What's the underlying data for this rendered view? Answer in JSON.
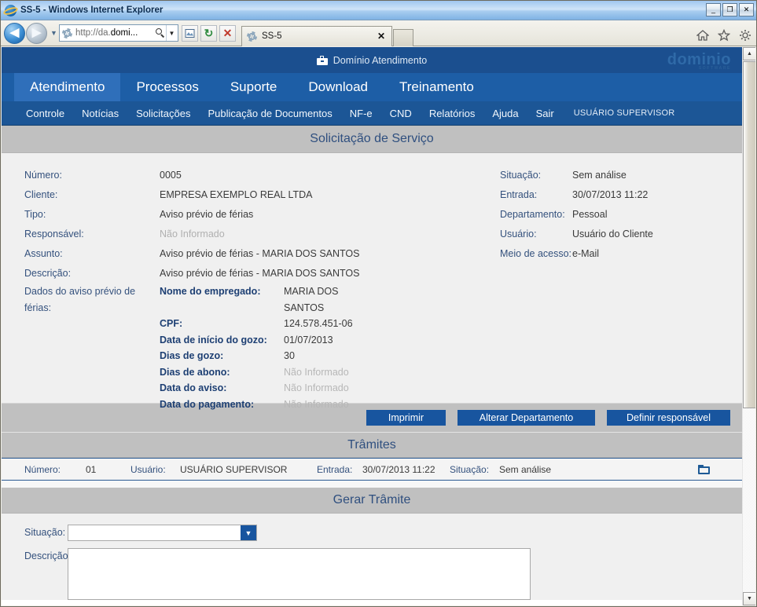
{
  "browser": {
    "title": "SS-5 - Windows Internet Explorer",
    "minimize_label": "_",
    "maximize_label": "❐",
    "close_label": "✕",
    "address_value_prefix": "http://da.",
    "address_value_suffix": "domi...",
    "back_label": "◀",
    "forward_label": "▶",
    "history_caret": "▼",
    "address_caret": "▼",
    "compat_icon": "compatibility-view-icon",
    "refresh_label": "↻",
    "stop_label": "✕",
    "tab_title": "SS-5",
    "tab_close_label": "✕",
    "home_icon": "home-icon",
    "favorites_icon": "star-icon",
    "tools_icon": "gear-icon"
  },
  "app": {
    "brand": "Domínio Atendimento",
    "logo": "dominio",
    "logo_sub": "SOFTWARE",
    "tabs": [
      {
        "label": "Atendimento",
        "active": true
      },
      {
        "label": "Processos",
        "active": false
      },
      {
        "label": "Suporte",
        "active": false
      },
      {
        "label": "Download",
        "active": false
      },
      {
        "label": "Treinamento",
        "active": false
      }
    ],
    "submenu": [
      "Controle",
      "Notícias",
      "Solicitações",
      "Publicação de Documentos",
      "NF-e",
      "CND",
      "Relatórios",
      "Ajuda",
      "Sair"
    ],
    "user": "USUÁRIO SUPERVISOR"
  },
  "page": {
    "section_title": "Solicitação de Serviço",
    "left_fields": [
      {
        "label": "Número:",
        "value": "0005",
        "muted": false
      },
      {
        "label": "Cliente:",
        "value": "EMPRESA EXEMPLO REAL LTDA",
        "muted": false
      },
      {
        "label": "Tipo:",
        "value": "Aviso prévio de férias",
        "muted": false
      },
      {
        "label": "Responsável:",
        "value": "Não Informado",
        "muted": true
      },
      {
        "label": "Assunto:",
        "value": "Aviso prévio de férias - MARIA DOS SANTOS",
        "muted": false
      },
      {
        "label": "Descrição:",
        "value": "Aviso prévio de férias - MARIA DOS SANTOS",
        "muted": false
      }
    ],
    "right_fields": [
      {
        "label": "Situação:",
        "value": "Sem análise",
        "muted": false
      },
      {
        "label": "Entrada:",
        "value": "30/07/2013 11:22",
        "muted": false
      },
      {
        "label": "Departamento:",
        "value": "Pessoal",
        "muted": false
      },
      {
        "label": "Usuário:",
        "value": "Usuário do Cliente",
        "muted": false
      },
      {
        "label": "Meio de acesso:",
        "value": "e-Mail",
        "muted": false
      }
    ],
    "dados_label": "Dados do aviso prévio de férias:",
    "dados_rows": [
      {
        "key": "Nome do empregado:",
        "value": "MARIA DOS SANTOS",
        "muted": false
      },
      {
        "key": "CPF:",
        "value": "124.578.451-06",
        "muted": false
      },
      {
        "key": "Data de início do gozo:",
        "value": "01/07/2013",
        "muted": false
      },
      {
        "key": "Dias de gozo:",
        "value": "30",
        "muted": false
      },
      {
        "key": "Dias de abono:",
        "value": "Não Informado",
        "muted": true
      },
      {
        "key": "Data do aviso:",
        "value": "Não Informado",
        "muted": true
      },
      {
        "key": "Data do pagamento:",
        "value": "Não Informado",
        "muted": true
      }
    ],
    "buttons": {
      "imprimir": "Imprimir",
      "alterar_departamento": "Alterar Departamento",
      "definir_responsavel": "Definir responsável"
    },
    "tramites": {
      "title": "Trâmites",
      "rows": [
        {
          "numero_label": "Número:",
          "numero": "01",
          "usuario_label": "Usuário:",
          "usuario": "USUÁRIO SUPERVISOR",
          "entrada_label": "Entrada:",
          "entrada": "30/07/2013 11:22",
          "situacao_label": "Situação:",
          "situacao": "Sem análise",
          "action_icon": "folder-icon"
        }
      ]
    },
    "gerar_tramite": {
      "title": "Gerar Trâmite",
      "situacao_label": "Situação:",
      "situacao_value": "",
      "situacao_caret": "▼",
      "descricao_label": "Descrição:",
      "descricao_value": ""
    }
  },
  "scrollbar": {
    "up_label": "▲",
    "down_label": "▼"
  },
  "colors": {
    "app_header_blue": "#1b4f8f",
    "app_tabs_blue": "#1d5ea6",
    "app_tab_active": "#2f6fba",
    "submenu_blue": "#1c5696",
    "section_gray": "#c0c0c0",
    "button_blue": "#18559f",
    "label_blue": "#34517d",
    "muted_text": "#b0b0b0"
  }
}
